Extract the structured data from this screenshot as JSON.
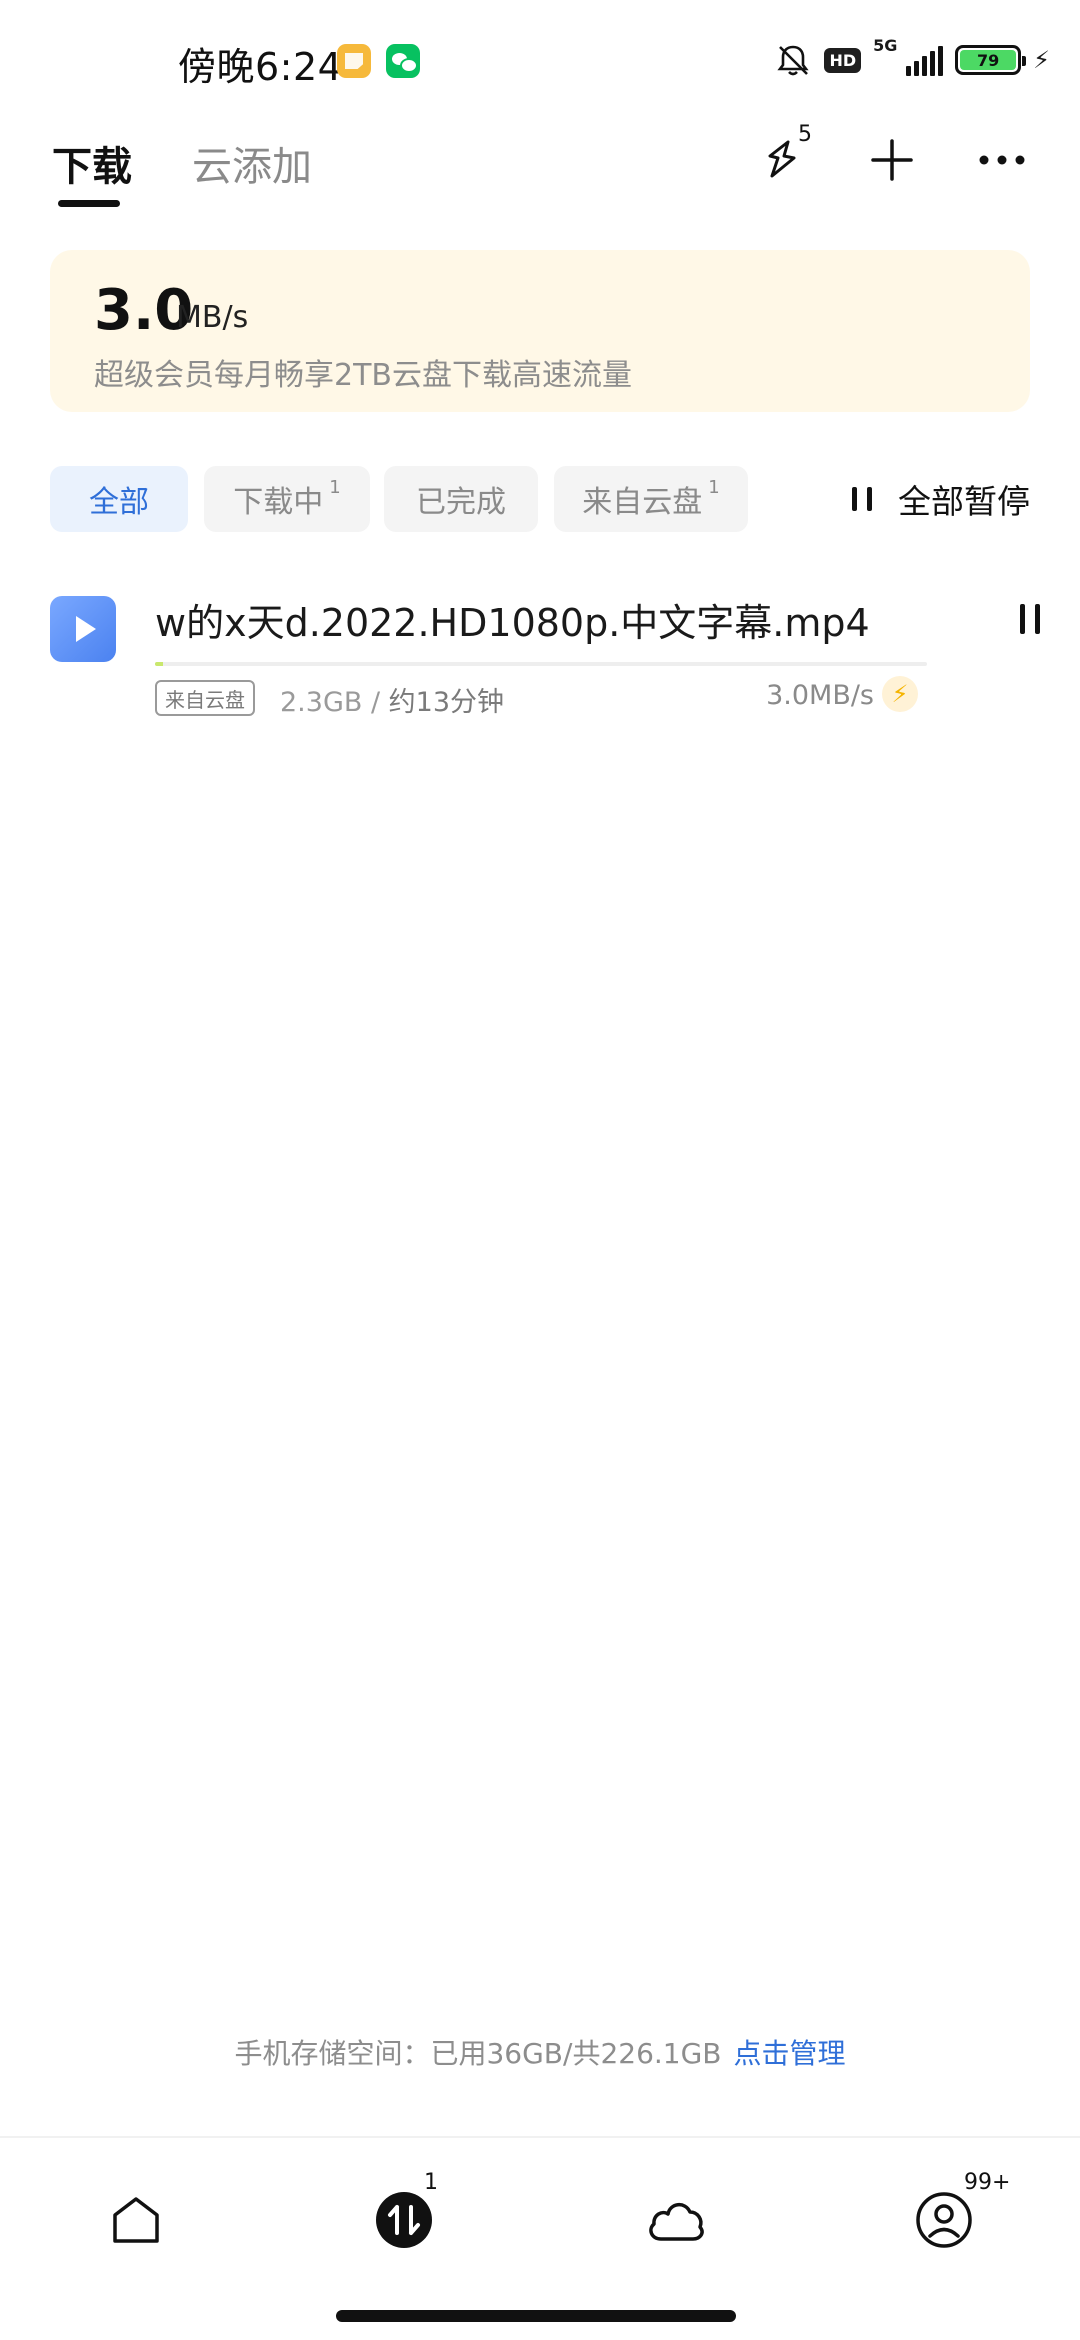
{
  "status_bar": {
    "time": "傍晚6:24",
    "hd_label": "HD",
    "network": "5G",
    "battery": "79",
    "app_badges": [
      "notes-icon",
      "wechat-icon"
    ]
  },
  "header": {
    "tab_active": "下载",
    "tab_inactive": "云添加",
    "notification_count": "5",
    "icons": [
      "speed-boost-icon",
      "plus-icon",
      "more-icon"
    ]
  },
  "banner": {
    "speed_value": "3.0",
    "speed_unit": "MB/s",
    "subtitle": "超级会员每月畅享2TB云盘下载高速流量"
  },
  "filters": [
    {
      "label": "全部",
      "count": "",
      "active": true
    },
    {
      "label": "下载中",
      "count": "1",
      "active": false
    },
    {
      "label": "已完成",
      "count": "",
      "active": false
    },
    {
      "label": "来自云盘",
      "count": "1",
      "active": false
    }
  ],
  "pause_all_label": "全部暂停",
  "download": {
    "title": "w的x天d.2022.HD1080p.中文字幕.mp4",
    "source_tag": "来自云盘",
    "size": "2.3GB",
    "separator": " / ",
    "eta": "约13分钟",
    "speed": "3.0MB/s",
    "progress": 0.01
  },
  "storage": {
    "text": "手机存储空间：已用36GB/共226.1GB",
    "manage_label": "点击管理"
  },
  "bottom_nav": {
    "transfer_badge": "1",
    "me_badge": "99+"
  },
  "colors": {
    "accent": "#2f6fd8",
    "banner_bg": "#fff8e7",
    "active_chip_bg": "#eaf2fd",
    "progress_fill": "#c9e86d"
  }
}
